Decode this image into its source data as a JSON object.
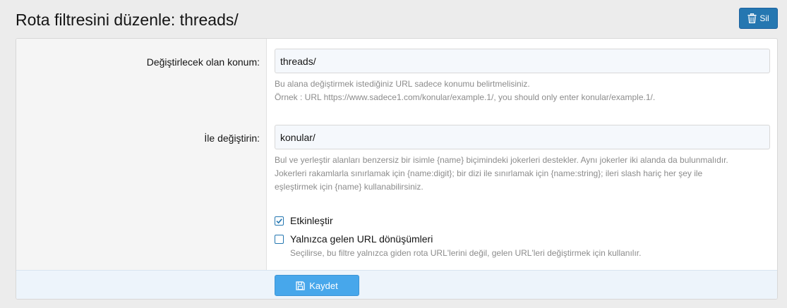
{
  "header": {
    "title": "Rota filtresini düzenle: threads/",
    "delete_label": "Sil"
  },
  "form": {
    "find": {
      "label": "Değiştirlecek olan konum:",
      "value": "threads/",
      "hint_line1": "Bu alana değiştirmek istediğiniz URL sadece konumu belirtmelisiniz.",
      "hint_line2": "Örnek : URL https://www.sadece1.com/konular/example.1/, you should only enter konular/example.1/."
    },
    "replace": {
      "label": "İle değiştirin:",
      "value": "konular/",
      "hint_line1": "Bul ve yerleştir alanları benzersiz bir isimle {name} biçimindeki jokerleri destekler. Aynı jokerler iki alanda da bulunmalıdır.",
      "hint_line2": "Jokerleri rakamlarla sınırlamak için {name:digit}; bir dizi ile sınırlamak için {name:string}; ileri slash hariç her şey ile",
      "hint_line3": "eşleştirmek için {name} kullanabilirsiniz."
    },
    "enable": {
      "label": "Etkinleştir",
      "checked": true
    },
    "incoming_only": {
      "label": "Yalnızca gelen URL dönüşümleri",
      "checked": false,
      "hint": "Seçilirse, bu filtre yalnızca giden rota URL'lerini değil, gelen URL'leri değiştirmek için kullanılır."
    }
  },
  "footer": {
    "save_label": "Kaydet"
  },
  "colors": {
    "primary": "#2577b1",
    "save_button": "#47a7eb"
  }
}
